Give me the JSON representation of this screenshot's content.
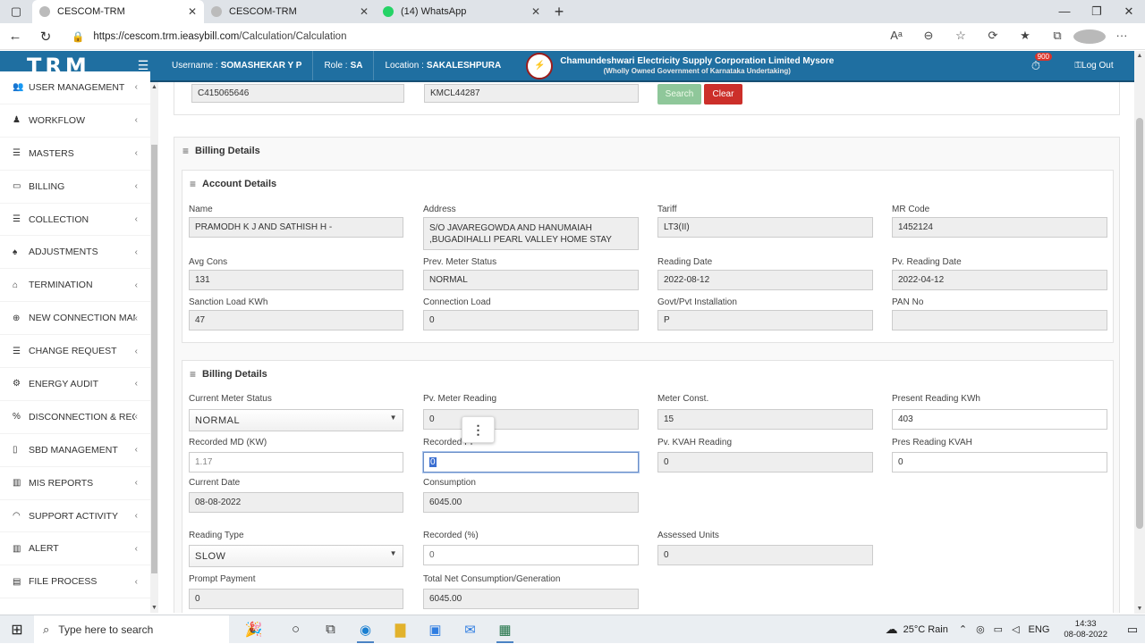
{
  "browser": {
    "tabs": [
      {
        "title": "CESCOM-TRM",
        "active": true
      },
      {
        "title": "CESCOM-TRM",
        "active": false
      },
      {
        "title": "(14) WhatsApp",
        "active": false
      }
    ],
    "url_host": "https://cescom.trm.ieasybill.com",
    "url_path": "/Calculation/Calculation"
  },
  "header": {
    "logo": "TRM",
    "username_label": "Username :",
    "username": "SOMASHEKAR Y P",
    "role_label": "Role :",
    "role": "SA",
    "location_label": "Location :",
    "location": "SAKALESHPURA",
    "corp_name": "Chamundeshwari Electricity Supply Corporation Limited Mysore",
    "corp_sub": "(Wholly Owned Government of Karnataka Undertaking)",
    "notif_count": "900",
    "logout": "Log Out"
  },
  "sidebar": {
    "items": [
      {
        "label": "USER MANAGEMENT",
        "icon": "users-icon"
      },
      {
        "label": "WORKFLOW",
        "icon": "user-icon"
      },
      {
        "label": "MASTERS",
        "icon": "list-icon"
      },
      {
        "label": "BILLING",
        "icon": "monitor-icon"
      },
      {
        "label": "COLLECTION",
        "icon": "list-icon"
      },
      {
        "label": "ADJUSTMENTS",
        "icon": "adjust-icon"
      },
      {
        "label": "TERMINATION",
        "icon": "trash-icon"
      },
      {
        "label": "NEW CONNECTION MANA...",
        "icon": "plus-circle-icon"
      },
      {
        "label": "CHANGE REQUEST",
        "icon": "list-icon"
      },
      {
        "label": "ENERGY AUDIT",
        "icon": "cogs-icon"
      },
      {
        "label": "DISCONNECTION & RECO...",
        "icon": "link-icon"
      },
      {
        "label": "SBD MANAGEMENT",
        "icon": "mobile-icon"
      },
      {
        "label": "MIS REPORTS",
        "icon": "bar-chart-icon"
      },
      {
        "label": "SUPPORT ACTIVITY",
        "icon": "headset-icon"
      },
      {
        "label": "ALERT",
        "icon": "bar-chart-icon"
      },
      {
        "label": "FILE PROCESS",
        "icon": "file-icon"
      }
    ]
  },
  "search": {
    "account_id": "C415065646",
    "rr_number": "KMCL44287",
    "search_label": "Search",
    "clear_label": "Clear"
  },
  "billing": {
    "section_title": "Billing Details",
    "account_title": "Account Details",
    "bill_title": "Billing Details",
    "account": {
      "name_label": "Name",
      "name": "PRAMODH K J AND SATHISH H  -",
      "address_label": "Address",
      "address_line1": "S/O JAVAREGOWDA AND HANUMAIAH",
      "address_line2": ",BUGADIHALLI PEARL VALLEY HOME STAY",
      "tariff_label": "Tariff",
      "tariff": "LT3(II)",
      "mrcode_label": "MR Code",
      "mrcode": "1452124",
      "avgcons_label": "Avg Cons",
      "avgcons": "131",
      "prevstatus_label": "Prev. Meter Status",
      "prevstatus": "NORMAL",
      "readdate_label": "Reading Date",
      "readdate": "2022-08-12",
      "pvreaddate_label": "Pv. Reading Date",
      "pvreaddate": "2022-04-12",
      "sanction_label": "Sanction Load KWh",
      "sanction": "47",
      "connload_label": "Connection Load",
      "connload": "0",
      "govt_label": "Govt/Pvt Installation",
      "govt": "P",
      "pan_label": "PAN No",
      "pan": ""
    },
    "bill": {
      "curstatus_label": "Current Meter Status",
      "curstatus": "NORMAL",
      "pvmeter_label": "Pv. Meter Reading",
      "pvmeter": "0",
      "meterconst_label": "Meter Const.",
      "meterconst": "15",
      "presentkwh_label": "Present Reading KWh",
      "presentkwh": "403",
      "recmd_label": "Recorded MD (KW)",
      "recmd": "1.17",
      "recpf_label": "Recorded PF",
      "recpf": "0",
      "pvkvah_label": "Pv. KVAH Reading",
      "pvkvah": "0",
      "preskvah_label": "Pres Reading KVAH",
      "preskvah": "0",
      "curdate_label": "Current Date",
      "curdate": "08-08-2022",
      "consumption_label": "Consumption",
      "consumption": "6045.00",
      "readtype_label": "Reading Type",
      "readtype": "SLOW",
      "recpct_label": "Recorded (%)",
      "recpct": "0",
      "assessed_label": "Assessed Units",
      "assessed": "0",
      "prompt_label": "Prompt Payment",
      "prompt": "0",
      "totalnet_label": "Total Net Consumption/Generation",
      "totalnet": "6045.00"
    }
  },
  "taskbar": {
    "search_placeholder": "Type here to search",
    "weather": "25°C  Rain",
    "lang": "ENG",
    "time": "14:33",
    "date": "08-08-2022"
  },
  "colors": {
    "header_bg": "#1f6fa1",
    "search_btn": "#8fc79a",
    "clear_btn": "#cc2f2a"
  }
}
